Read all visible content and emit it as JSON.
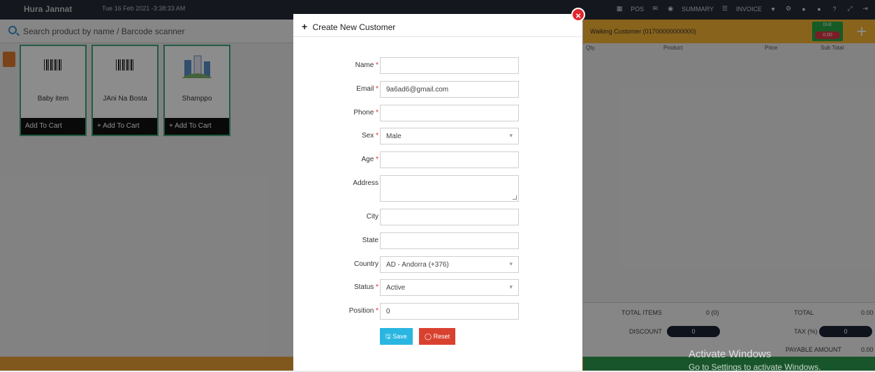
{
  "topbar": {
    "user": "Hura Jannat",
    "datetime": "Tue 16 Feb 2021 -3:38:33 AM",
    "nav": {
      "pos": "POS",
      "summary": "SUMMARY",
      "invoice": "INVOICE"
    }
  },
  "search": {
    "placeholder": "Search product by name / Barcode scanner"
  },
  "products": [
    {
      "name": "Baby item",
      "add_label": "Add To Cart"
    },
    {
      "name": "JAni Na Bosta",
      "add_label": "Add To Cart"
    },
    {
      "name": "Shamppo",
      "add_label": "Add To Cart"
    }
  ],
  "cart": {
    "customer": "Walking Customer (01700000000000)",
    "due_label": "DUE",
    "due_amount": "0.00",
    "columns": [
      "Qty.",
      "Product",
      "Price",
      "Sub Total"
    ],
    "total_items_label": "TOTAL ITEMS",
    "total_items_value": "0 (0)",
    "total_label": "TOTAL",
    "total_value": "0.00",
    "discount_label": "DISCOUNT",
    "discount_value": "0",
    "tax_label": "TAX (%)",
    "tax_value": "0",
    "payable_label": "PAYABLE AMOUNT",
    "payable_value": "0.00"
  },
  "watermark": {
    "line1": "Activate Windows",
    "line2": "Go to Settings to activate Windows."
  },
  "modal": {
    "title": "Create New Customer",
    "fields": {
      "name": {
        "label": "Name",
        "value": ""
      },
      "email": {
        "label": "Email",
        "value": "9a6ad6@gmail.com"
      },
      "phone": {
        "label": "Phone",
        "value": ""
      },
      "sex": {
        "label": "Sex",
        "value": "Male"
      },
      "age": {
        "label": "Age",
        "value": ""
      },
      "address": {
        "label": "Address",
        "value": ""
      },
      "city": {
        "label": "City",
        "value": ""
      },
      "state": {
        "label": "State",
        "value": ""
      },
      "country": {
        "label": "Country",
        "value": "AD - Andorra (+376)"
      },
      "status": {
        "label": "Status",
        "value": "Active"
      },
      "position": {
        "label": "Position",
        "value": "0"
      }
    },
    "save_label": "Save",
    "reset_label": "Reset"
  },
  "colors": {
    "required": "#e2262d",
    "save": "#29b6e0",
    "reset": "#d9412f",
    "card_border": "#3fa87a",
    "cart_header": "#f7b534"
  }
}
